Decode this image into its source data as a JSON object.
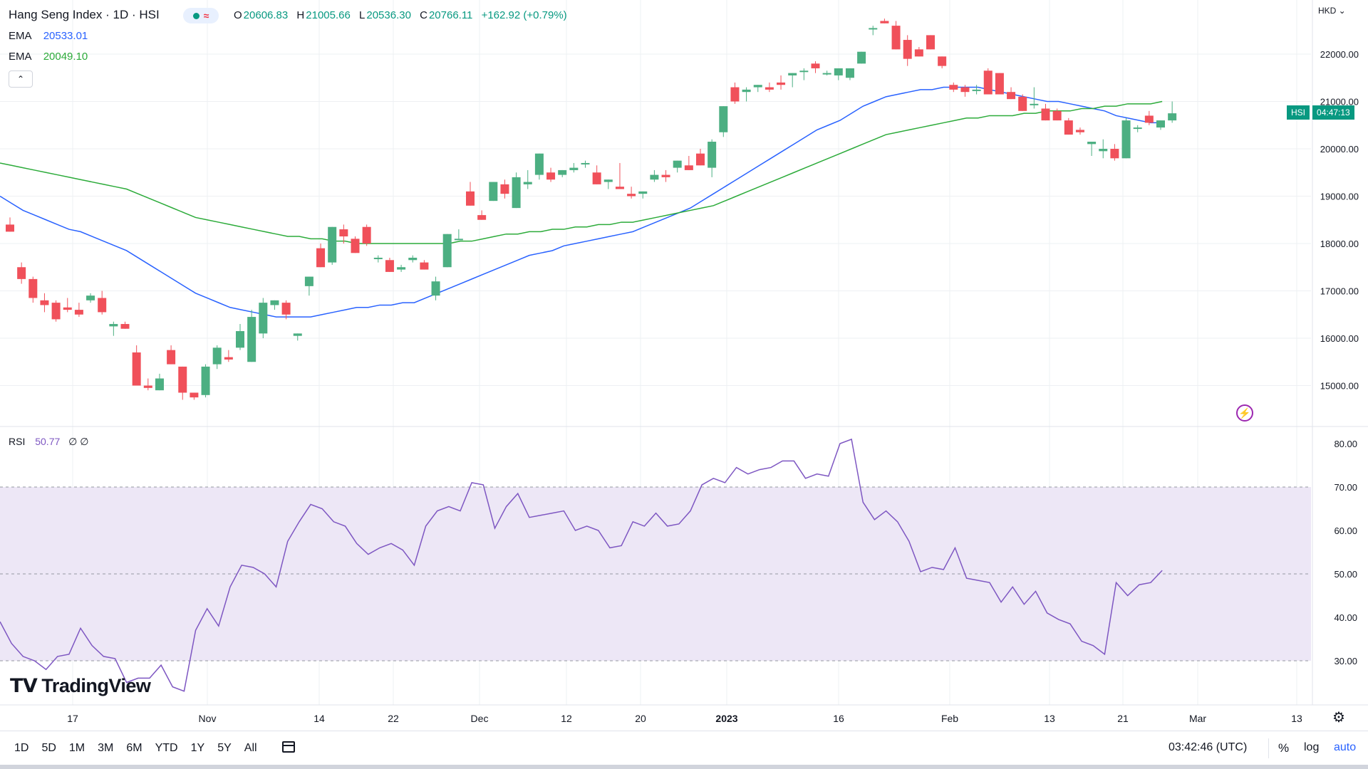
{
  "header": {
    "title": "Hang Seng Index · 1D · HSI",
    "ohlc": {
      "o_label": "O",
      "o": "20606.83",
      "h_label": "H",
      "h": "21005.66",
      "l_label": "L",
      "l": "20536.30",
      "c_label": "C",
      "c": "20766.11",
      "change": "+162.92 (+0.79%)"
    },
    "ema1_label": "EMA",
    "ema1_value": "20533.01",
    "ema2_label": "EMA",
    "ema2_value": "20049.10",
    "collapse_icon": "chevron-up-icon",
    "currency": "HKD"
  },
  "rsi_legend": {
    "label": "RSI",
    "value": "50.77",
    "extra": "∅ ∅"
  },
  "price_tag": {
    "symbol": "HSI",
    "countdown": "04:47:13"
  },
  "logo": "TradingView",
  "colors": {
    "up": "#4caf82",
    "down": "#f0505a",
    "ema_fast": "#2962ff",
    "ema_slow": "#2cab3a",
    "rsi_line": "#7e57c2",
    "rsi_band": "#ede7f6",
    "grid": "#eef0f3",
    "accent": "#2962ff"
  },
  "bottom_bar": {
    "ranges": [
      "1D",
      "5D",
      "1M",
      "3M",
      "6M",
      "YTD",
      "1Y",
      "5Y",
      "All"
    ],
    "time": "03:42:46 (UTC)",
    "percent": "%",
    "log": "log",
    "auto": "auto"
  },
  "chart_data": [
    {
      "type": "candlestick",
      "title": "Hang Seng Index · 1D · HSI",
      "ylim": [
        14400,
        23000
      ],
      "y_ticks": [
        "15000.00",
        "16000.00",
        "17000.00",
        "18000.00",
        "19000.00",
        "20000.00",
        "21000.00",
        "22000.00"
      ],
      "x_ticks": [
        "17",
        "Nov",
        "14",
        "22",
        "Dec",
        "12",
        "20",
        "2023",
        "16",
        "Feb",
        "13",
        "21",
        "Mar",
        "13"
      ],
      "candles": [
        [
          18400,
          18550,
          18350,
          18250
        ],
        [
          17500,
          17600,
          17150,
          17250
        ],
        [
          17250,
          17300,
          16750,
          16850
        ],
        [
          16800,
          16950,
          16550,
          16700
        ],
        [
          16750,
          16800,
          16350,
          16400
        ],
        [
          16650,
          16850,
          16550,
          16600
        ],
        [
          16600,
          16750,
          16450,
          16500
        ],
        [
          16800,
          16950,
          16750,
          16900
        ],
        [
          16850,
          17000,
          16500,
          16550
        ],
        [
          16250,
          16350,
          16050,
          16300
        ],
        [
          16300,
          16350,
          16250,
          16200
        ],
        [
          15700,
          15850,
          15000,
          15000
        ],
        [
          15000,
          15150,
          14900,
          14950
        ],
        [
          14900,
          15250,
          14900,
          15150
        ],
        [
          15750,
          15850,
          15500,
          15450
        ],
        [
          15400,
          15400,
          14700,
          14850
        ],
        [
          14850,
          14700,
          14700,
          14750
        ],
        [
          14800,
          15450,
          14750,
          15400
        ],
        [
          15450,
          15850,
          15350,
          15800
        ],
        [
          15600,
          15750,
          15500,
          15550
        ],
        [
          15800,
          16300,
          15750,
          16150
        ],
        [
          15500,
          16600,
          15500,
          16450
        ],
        [
          16100,
          16850,
          16000,
          16750
        ],
        [
          16700,
          16800,
          16600,
          16800
        ],
        [
          16750,
          16800,
          16400,
          16500
        ],
        [
          16050,
          16100,
          15950,
          16100
        ],
        [
          17100,
          17250,
          16900,
          17300
        ],
        [
          17900,
          18000,
          17500,
          17500
        ],
        [
          17600,
          18350,
          17550,
          18350
        ],
        [
          18300,
          18400,
          18000,
          18150
        ],
        [
          18100,
          18150,
          18000,
          17800
        ],
        [
          18350,
          18400,
          17950,
          18000
        ],
        [
          17700,
          17750,
          17600,
          17700
        ],
        [
          17650,
          17700,
          17500,
          17400
        ],
        [
          17450,
          17550,
          17400,
          17500
        ],
        [
          17650,
          17750,
          17600,
          17700
        ],
        [
          17600,
          17650,
          17500,
          17450
        ],
        [
          16900,
          17300,
          16800,
          17200
        ],
        [
          17500,
          18200,
          17500,
          18200
        ],
        [
          18100,
          18300,
          18100,
          18100
        ],
        [
          19100,
          19300,
          18800,
          18800
        ],
        [
          18600,
          18700,
          18550,
          18500
        ],
        [
          18900,
          19300,
          18900,
          19300
        ],
        [
          19250,
          19350,
          18950,
          19050
        ],
        [
          18750,
          19500,
          18750,
          19400
        ],
        [
          19250,
          19550,
          19150,
          19300
        ],
        [
          19450,
          19900,
          19350,
          19900
        ],
        [
          19500,
          19600,
          19300,
          19350
        ],
        [
          19450,
          19550,
          19400,
          19550
        ],
        [
          19550,
          19700,
          19500,
          19600
        ],
        [
          19700,
          19750,
          19600,
          19700
        ],
        [
          19500,
          19650,
          19300,
          19250
        ],
        [
          19300,
          19350,
          19150,
          19350
        ],
        [
          19200,
          19700,
          19150,
          19150
        ],
        [
          19050,
          19200,
          18950,
          19000
        ],
        [
          19050,
          19100,
          18950,
          19100
        ],
        [
          19350,
          19550,
          19300,
          19450
        ],
        [
          19450,
          19550,
          19300,
          19400
        ],
        [
          19600,
          19750,
          19500,
          19750
        ],
        [
          19650,
          19850,
          19600,
          19550
        ],
        [
          19900,
          20000,
          19650,
          19650
        ],
        [
          19600,
          20200,
          19400,
          20150
        ],
        [
          20350,
          20900,
          20250,
          20900
        ],
        [
          21300,
          21400,
          20950,
          21000
        ],
        [
          21200,
          21300,
          21000,
          21250
        ],
        [
          21300,
          21350,
          21200,
          21350
        ],
        [
          21300,
          21400,
          21200,
          21250
        ],
        [
          21400,
          21550,
          21250,
          21350
        ],
        [
          21550,
          21600,
          21300,
          21600
        ],
        [
          21650,
          21700,
          21450,
          21650
        ],
        [
          21800,
          21850,
          21600,
          21700
        ],
        [
          21600,
          21650,
          21550,
          21600
        ],
        [
          21550,
          21700,
          21450,
          21700
        ],
        [
          21500,
          21700,
          21450,
          21700
        ],
        [
          21800,
          22050,
          21800,
          22050
        ],
        [
          22550,
          22600,
          22400,
          22550
        ],
        [
          22700,
          22750,
          22650,
          22650
        ],
        [
          22600,
          22700,
          22100,
          22100
        ],
        [
          22300,
          22400,
          21750,
          21900
        ],
        [
          22100,
          22150,
          21950,
          21950
        ],
        [
          22400,
          22400,
          22100,
          22100
        ],
        [
          21950,
          21950,
          21700,
          21750
        ],
        [
          21350,
          21400,
          21200,
          21250
        ],
        [
          21300,
          21350,
          21100,
          21200
        ],
        [
          21250,
          21350,
          21150,
          21250
        ],
        [
          21650,
          21700,
          21150,
          21150
        ],
        [
          21600,
          21600,
          21150,
          21150
        ],
        [
          21200,
          21300,
          21100,
          21050
        ],
        [
          21100,
          21150,
          20850,
          20800
        ],
        [
          20950,
          21300,
          20850,
          20950
        ],
        [
          20850,
          20950,
          20650,
          20600
        ],
        [
          20800,
          20850,
          20600,
          20600
        ],
        [
          20600,
          20650,
          20300,
          20300
        ],
        [
          20400,
          20450,
          20300,
          20350
        ],
        [
          20100,
          20150,
          19850,
          20150
        ],
        [
          19950,
          20200,
          19800,
          20000
        ],
        [
          20000,
          20100,
          19750,
          19800
        ],
        [
          19800,
          20650,
          19800,
          20600
        ],
        [
          20450,
          20500,
          20350,
          20450
        ],
        [
          20700,
          20800,
          20500,
          20550
        ],
        [
          20450,
          20600,
          20400,
          20600
        ],
        [
          20600,
          21000,
          20550,
          20750
        ]
      ],
      "series": [
        {
          "name": "EMA",
          "values": [
            19000,
            18850,
            18700,
            18600,
            18500,
            18400,
            18300,
            18250,
            18150,
            18050,
            17950,
            17850,
            17700,
            17550,
            17400,
            17250,
            17100,
            16950,
            16850,
            16750,
            16650,
            16600,
            16550,
            16500,
            16450,
            16450,
            16450,
            16450,
            16500,
            16550,
            16600,
            16650,
            16650,
            16700,
            16700,
            16750,
            16750,
            16850,
            16950,
            17050,
            17150,
            17250,
            17350,
            17450,
            17550,
            17650,
            17750,
            17800,
            17850,
            17950,
            18000,
            18050,
            18100,
            18150,
            18200,
            18250,
            18350,
            18450,
            18550,
            18650,
            18750,
            18900,
            19050,
            19200,
            19350,
            19500,
            19650,
            19800,
            19950,
            20100,
            20250,
            20400,
            20500,
            20600,
            20750,
            20900,
            21000,
            21100,
            21150,
            21200,
            21250,
            21250,
            21300,
            21300,
            21300,
            21300,
            21250,
            21200,
            21150,
            21100,
            21050,
            21000,
            21000,
            20950,
            20900,
            20850,
            20800,
            20700,
            20650,
            20600,
            20550,
            20550
          ]
        },
        {
          "name": "EMA",
          "values": [
            19700,
            19650,
            19600,
            19550,
            19500,
            19450,
            19400,
            19350,
            19300,
            19250,
            19200,
            19150,
            19050,
            18950,
            18850,
            18750,
            18650,
            18550,
            18500,
            18450,
            18400,
            18350,
            18300,
            18250,
            18200,
            18150,
            18150,
            18100,
            18100,
            18050,
            18050,
            18000,
            18000,
            18000,
            18000,
            18000,
            18000,
            18000,
            18000,
            18000,
            18050,
            18050,
            18100,
            18150,
            18200,
            18200,
            18250,
            18250,
            18300,
            18300,
            18350,
            18350,
            18400,
            18400,
            18450,
            18450,
            18500,
            18550,
            18600,
            18650,
            18700,
            18750,
            18800,
            18900,
            19000,
            19100,
            19200,
            19300,
            19400,
            19500,
            19600,
            19700,
            19800,
            19900,
            20000,
            20100,
            20200,
            20300,
            20350,
            20400,
            20450,
            20500,
            20550,
            20600,
            20650,
            20650,
            20700,
            20700,
            20700,
            20750,
            20750,
            20800,
            20800,
            20800,
            20850,
            20850,
            20900,
            20900,
            20950,
            20950,
            20950,
            21000
          ]
        }
      ]
    },
    {
      "type": "line",
      "title": "RSI",
      "ylim": [
        20,
        82
      ],
      "y_ticks": [
        "30.00",
        "40.00",
        "50.00",
        "60.00",
        "70.00",
        "80.00"
      ],
      "band": [
        30,
        70
      ],
      "midline": 50,
      "series": [
        {
          "name": "RSI",
          "values": [
            39,
            34,
            31,
            30,
            28,
            31,
            31.5,
            37.5,
            33.5,
            31,
            30.5,
            25,
            26,
            26,
            29,
            24,
            23,
            37,
            42,
            38,
            47,
            52,
            51.5,
            50,
            47,
            57.5,
            62,
            66,
            65,
            62,
            61,
            57,
            54.5,
            56,
            57,
            55.5,
            52,
            61,
            64.5,
            65.5,
            64.5,
            71,
            70.5,
            60.5,
            65.5,
            68.5,
            63,
            63.5,
            64,
            64.5,
            60,
            61,
            60,
            56,
            56.5,
            62,
            61,
            64,
            61,
            61.5,
            64.5,
            70.5,
            72,
            71,
            74.5,
            73,
            74,
            74.5,
            76,
            76,
            72,
            73,
            72.5,
            80,
            81,
            66.5,
            62.5,
            64.5,
            62,
            57.5,
            50.5,
            51.5,
            51,
            56,
            49,
            48.5,
            48,
            43.5,
            47,
            43,
            46,
            41,
            39.5,
            38.5,
            34.5,
            33.5,
            31.5,
            48,
            45,
            47.5,
            48,
            50.8
          ]
        }
      ]
    }
  ]
}
